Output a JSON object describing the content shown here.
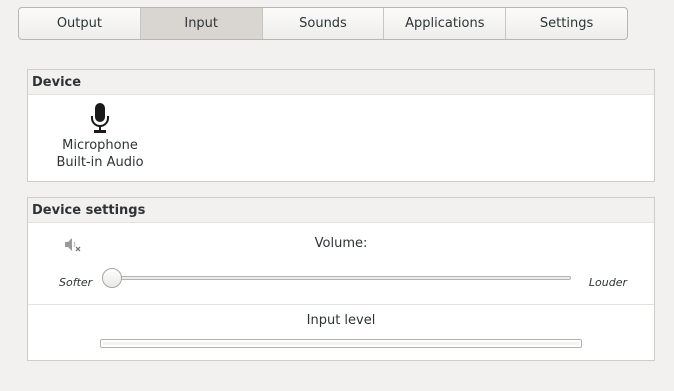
{
  "tabs": [
    {
      "label": "Output",
      "active": false
    },
    {
      "label": "Input",
      "active": true
    },
    {
      "label": "Sounds",
      "active": false
    },
    {
      "label": "Applications",
      "active": false
    },
    {
      "label": "Settings",
      "active": false
    }
  ],
  "device_section": {
    "title": "Device",
    "device": {
      "icon": "microphone-icon",
      "name": "Microphone",
      "description": "Built-in Audio"
    }
  },
  "settings_section": {
    "title": "Device settings",
    "mute_icon": "speaker-muted-icon",
    "volume_label": "Volume:",
    "volume_level": 0,
    "softer_label": "Softer",
    "louder_label": "Louder",
    "input_level_label": "Input level",
    "input_level": 0
  },
  "colors": {
    "background": "#f2f1f0",
    "active_tab": "#d9d6d2",
    "text": "#2e3436"
  }
}
